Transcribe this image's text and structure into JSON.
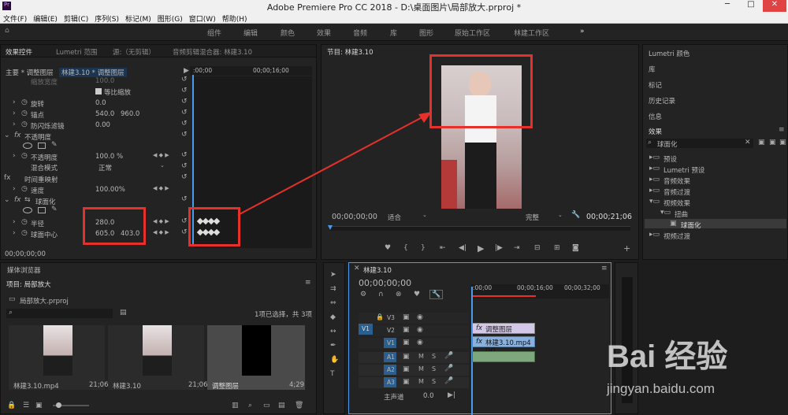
{
  "window": {
    "title": "Adobe Premiere Pro CC 2018 - D:\\桌面图片\\局部放大.prproj *",
    "min": "─",
    "max": "□",
    "close": "✕"
  },
  "menu": [
    "文件(F)",
    "编辑(E)",
    "剪辑(C)",
    "序列(S)",
    "标记(M)",
    "图形(G)",
    "窗口(W)",
    "帮助(H)"
  ],
  "workspaces": [
    "组件",
    "编辑",
    "颜色",
    "效果",
    "音频",
    "库",
    "图形",
    "原始工作区",
    "林建工作区"
  ],
  "workspace_more": "»",
  "effect_controls": {
    "tabs": [
      "效果控件",
      "Lumetri 范围",
      "源:（无剪辑）",
      "音频剪辑混合器: 林建3.10"
    ],
    "clip_header": "主要 * 调整图层",
    "clip_active": "林建3.10 * 调整图层",
    "ruler": [
      ":00;00",
      "00;00;16;00"
    ],
    "rows": [
      {
        "label": "缩放宽度",
        "v1": "100.0",
        "v2": ""
      },
      {
        "label": "等比缩放",
        "v1": "",
        "v2": ""
      },
      {
        "label": "旋转",
        "v1": "0.0",
        "v2": ""
      },
      {
        "label": "锚点",
        "v1": "540.0",
        "v2": "960.0"
      },
      {
        "label": "防闪烁滤镜",
        "v1": "0.00",
        "v2": ""
      },
      {
        "label": "不透明度",
        "v1": "",
        "v2": ""
      },
      {
        "label": "不透明度",
        "v1": "100.0 %",
        "v2": ""
      },
      {
        "label": "混合模式",
        "v1": "正常",
        "v2": ""
      },
      {
        "label": "时间重映射",
        "v1": "",
        "v2": ""
      },
      {
        "label": "速度",
        "v1": "100.00%",
        "v2": ""
      },
      {
        "label": "球面化",
        "v1": "",
        "v2": ""
      },
      {
        "label": "半径",
        "v1": "280.0",
        "v2": ""
      },
      {
        "label": "球面中心",
        "v1": "605.0",
        "v2": "403.0"
      }
    ],
    "timecode": "00;00;00;00"
  },
  "program": {
    "title": "节目: 林建3.10",
    "timecode_left": "00;00;00;00",
    "fit": "适合",
    "quality": "完整",
    "timecode_right": "00;00;21;06"
  },
  "right_panel": {
    "items": [
      "Lumetri 颜色",
      "库",
      "标记",
      "历史记录",
      "信息"
    ],
    "effects_title": "效果",
    "search_value": "球面化",
    "tree": [
      "预设",
      "Lumetri 预设",
      "音频效果",
      "音频过渡",
      "视频效果",
      "扭曲",
      "球面化",
      "视频过渡"
    ]
  },
  "project": {
    "tabs": [
      "媒体浏览器"
    ],
    "title": "项目: 局部放大",
    "file": "局部放大.prproj",
    "selection": "1项已选择，共 3项",
    "items": [
      {
        "name": "林建3.10.mp4",
        "dur": "21;06"
      },
      {
        "name": "林建3.10",
        "dur": "21;06"
      },
      {
        "name": "调整图层",
        "dur": "4;29"
      }
    ]
  },
  "timeline": {
    "title": "林建3.10",
    "timecode": "00;00;00;00",
    "ruler": [
      ":00;00",
      "00;00;16;00",
      "00;00;32;00"
    ],
    "tracks_v": [
      "V3",
      "V2",
      "V1"
    ],
    "tracks_a": [
      "A1",
      "A2",
      "A3"
    ],
    "master": "主声道",
    "master_val": "0.0",
    "clip_adjust": "调整图层",
    "clip_video": "林建3.10.mp4 [V]",
    "src_v": "V1"
  },
  "watermark": {
    "brand": "Bai 经验",
    "url": "jingyan.baidu.com"
  },
  "colors": {
    "accent": "#4b9be8",
    "red": "#e8302a",
    "bg": "#232323"
  }
}
